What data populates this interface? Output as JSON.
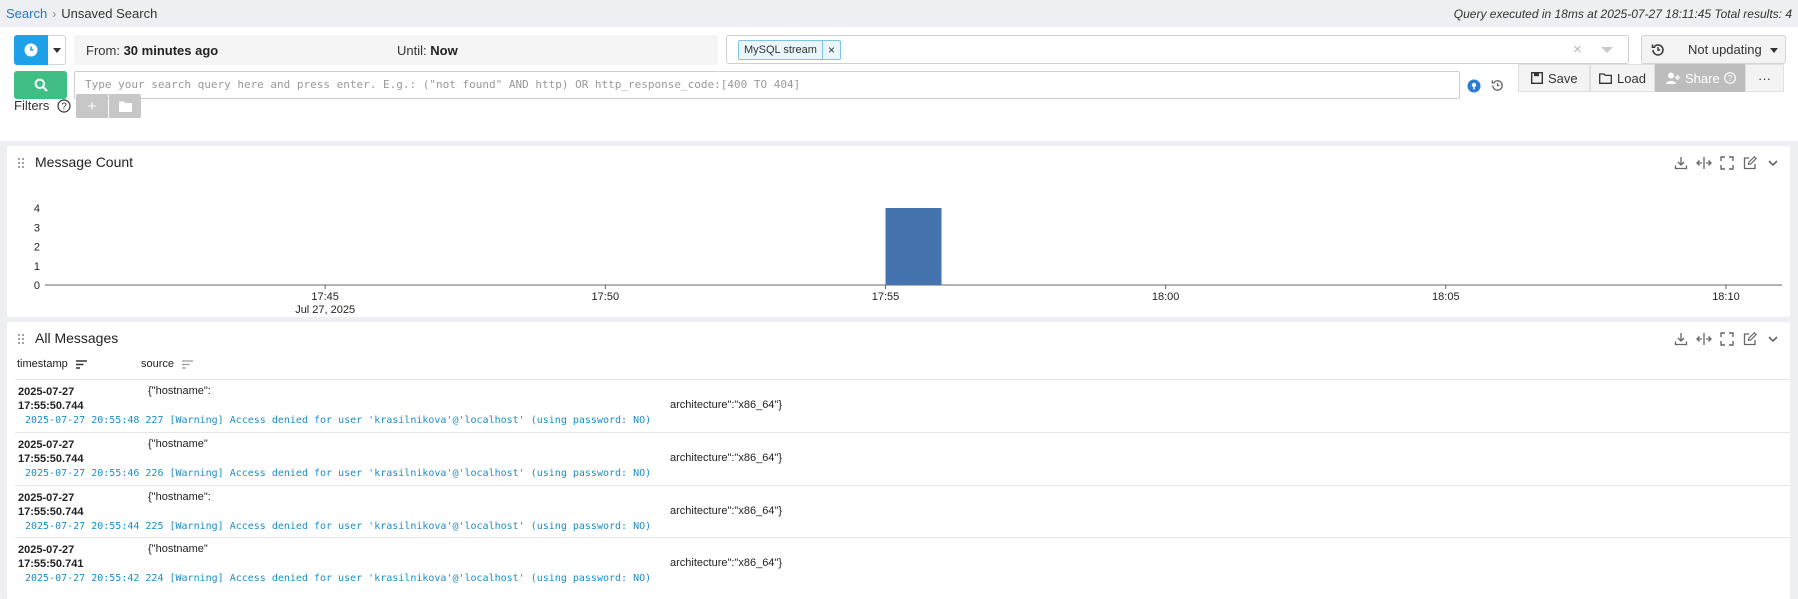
{
  "breadcrumb": {
    "root": "Search",
    "separator": "›",
    "current": "Unsaved Search"
  },
  "query_info": "Query executed in 18ms at 2025-07-27 18:11:45 Total results: 4",
  "timerange": {
    "from_label": "From:",
    "from_value": "30 minutes ago",
    "until_label": "Until:",
    "until_value": "Now"
  },
  "streams": {
    "selected": "MySQL stream",
    "remove_glyph": "×",
    "clear_glyph": "×"
  },
  "refresh": {
    "label": "Not updating"
  },
  "search": {
    "placeholder": "Type your search query here and press enter. E.g.: (\"not found\" AND http) OR http_response_code:[400 TO 404]"
  },
  "actions": {
    "save": "Save",
    "load": "Load",
    "share": "Share",
    "more": "···"
  },
  "filters": {
    "label": "Filters",
    "add": "+"
  },
  "chart_widget": {
    "title": "Message Count"
  },
  "chart_data": {
    "type": "bar",
    "title": "Message Count",
    "x_ticks": [
      "17:45",
      "17:50",
      "17:55",
      "18:00",
      "18:05",
      "18:10"
    ],
    "x_date_label": "Jul 27, 2025",
    "y_ticks": [
      0,
      1,
      2,
      3,
      4
    ],
    "ylim": [
      0,
      4
    ],
    "xlim": [
      "17:40",
      "18:11"
    ],
    "bars": [
      {
        "x_start": "17:55",
        "x_end": "17:56",
        "value": 4
      }
    ],
    "color": "#4573ae",
    "grid": false
  },
  "messages_widget": {
    "title": "All Messages",
    "columns": {
      "timestamp": "timestamp",
      "source": "source"
    },
    "rows": [
      {
        "date": "2025-07-27",
        "time": "17:55:50.744",
        "src1": "{\"hostname\":",
        "src2": "architecture\":\"x86_64\"}",
        "message": "2025-07-27 20:55:48 227 [Warning] Access denied for user 'krasilnikova'@'localhost' (using password: NO)"
      },
      {
        "date": "2025-07-27",
        "time": "17:55:50.744",
        "src1": "{\"hostname\"",
        "src2": "architecture\":\"x86_64\"}",
        "message": "2025-07-27 20:55:46 226 [Warning] Access denied for user 'krasilnikova'@'localhost' (using password: NO)"
      },
      {
        "date": "2025-07-27",
        "time": "17:55:50.744",
        "src1": "{\"hostname\":",
        "src2": "architecture\":\"x86_64\"}",
        "message": "2025-07-27 20:55:44 225 [Warning] Access denied for user 'krasilnikova'@'localhost' (using password: NO)"
      },
      {
        "date": "2025-07-27",
        "time": "17:55:50.741",
        "src1": "{\"hostname\"",
        "src2": "architecture\":\"x86_64\"}",
        "message": "2025-07-27 20:55:42 224 [Warning] Access denied for user 'krasilnikova'@'localhost' (using password: NO)"
      }
    ]
  }
}
